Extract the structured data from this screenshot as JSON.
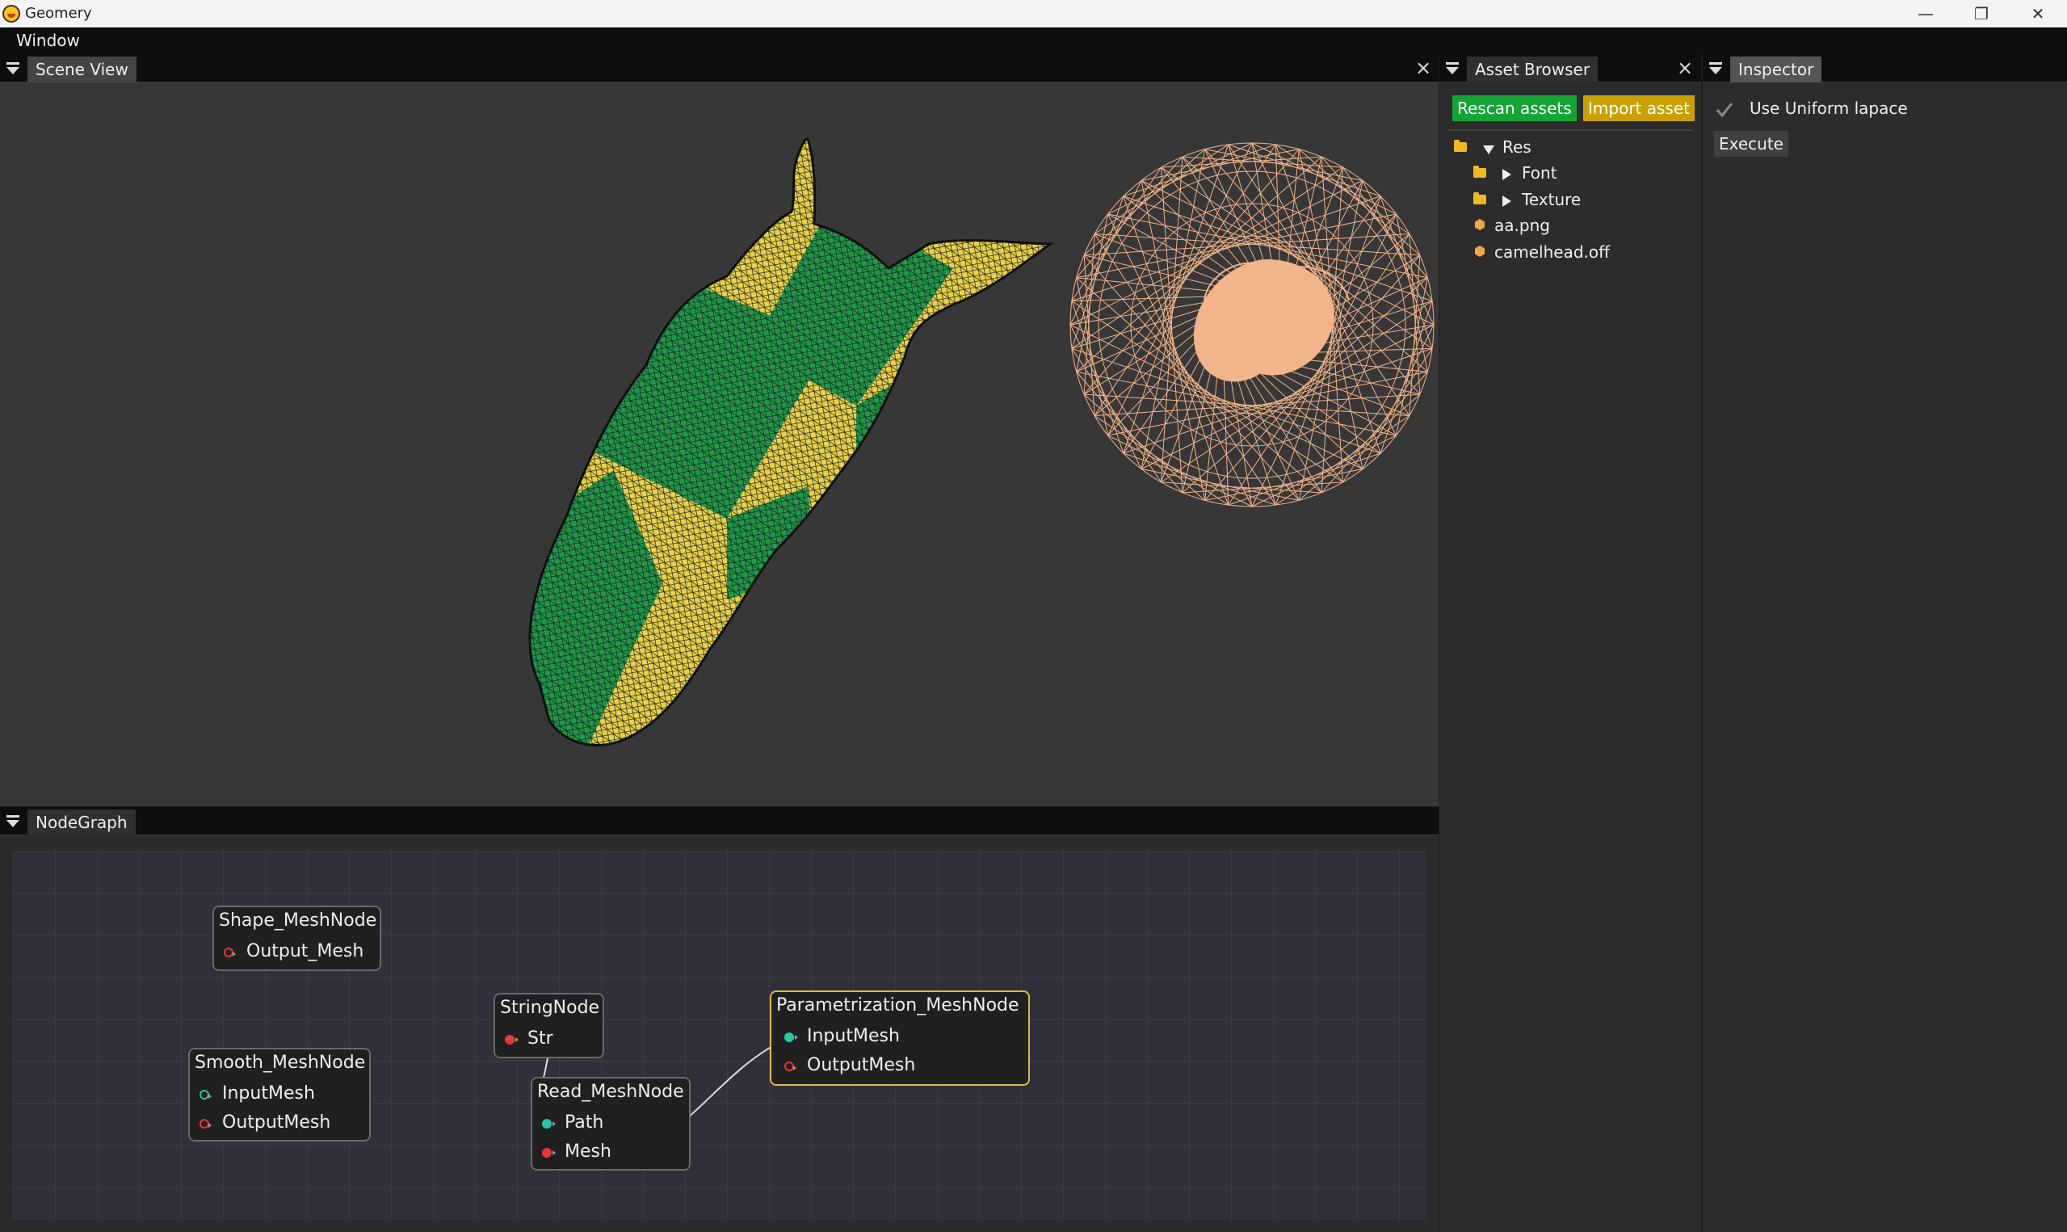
{
  "window": {
    "title": "Geomery"
  },
  "menubar": {
    "items": [
      "Window"
    ]
  },
  "scene_view": {
    "tab_label": "Scene View"
  },
  "asset_browser": {
    "tab_label": "Asset Browser",
    "rescan_label": "Rescan assets",
    "import_label": "Import asset",
    "tree": {
      "root": "Res",
      "folders": [
        "Font",
        "Texture"
      ],
      "files": [
        "aa.png",
        "camelhead.off"
      ]
    }
  },
  "inspector": {
    "tab_label": "Inspector",
    "checkbox_label": "Use Uniform lapace",
    "checkbox_checked": true,
    "execute_label": "Execute"
  },
  "node_graph": {
    "tab_label": "NodeGraph",
    "nodes": {
      "shape": {
        "title": "Shape_MeshNode",
        "ports": [
          "Output_Mesh"
        ]
      },
      "smooth": {
        "title": "Smooth_MeshNode",
        "ports": [
          "InputMesh",
          "OutputMesh"
        ]
      },
      "string": {
        "title": "StringNode",
        "ports": [
          "Str"
        ]
      },
      "read": {
        "title": "Read_MeshNode",
        "ports": [
          "Path",
          "Mesh"
        ]
      },
      "param": {
        "title": "Parametrization_MeshNode",
        "ports": [
          "InputMesh",
          "OutputMesh"
        ]
      }
    }
  },
  "colors": {
    "rescan_button": "#14a334",
    "import_button": "#c9a000",
    "mesh_yellow": "#e8d24a",
    "mesh_green": "#1f9a4a",
    "param_lines": "#f2b48a",
    "selected_node_border": "#e0b84a"
  }
}
